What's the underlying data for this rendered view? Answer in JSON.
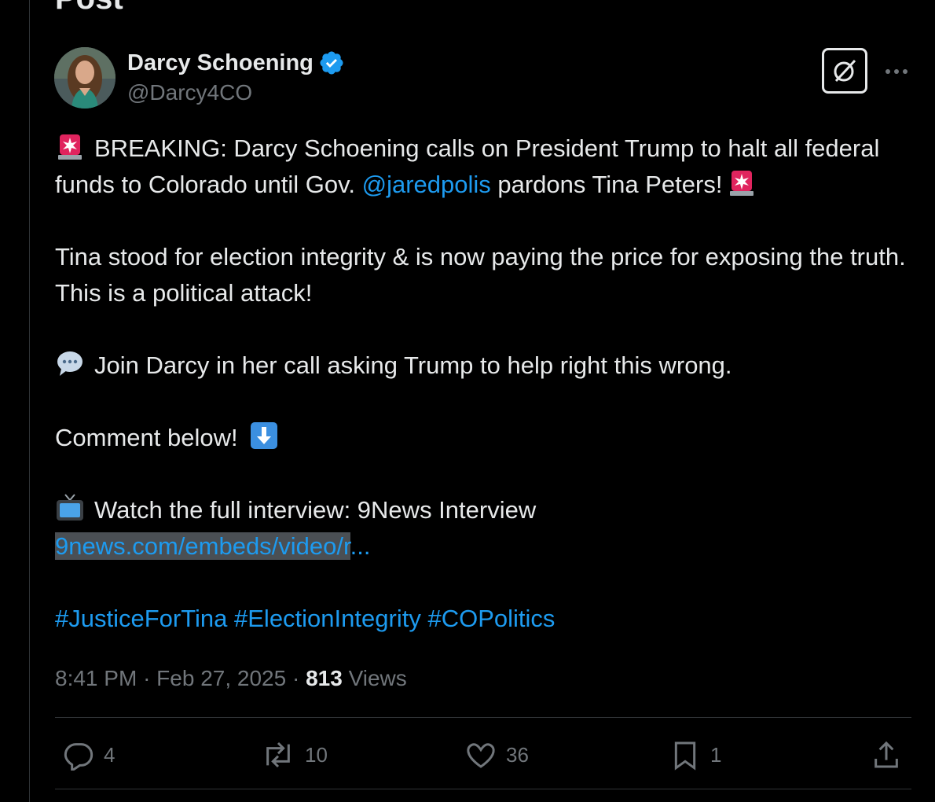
{
  "header": {
    "title": "Post"
  },
  "author": {
    "name": "Darcy Schoening",
    "handle": "@Darcy4CO",
    "avatar_icon": "profile-photo"
  },
  "tweet": {
    "line1_prefix": "BREAKING: Darcy Schoening calls on President Trump to halt all federal funds to Colorado until Gov. ",
    "mention": "@jaredpolis",
    "line1_suffix": " pardons Tina Peters!",
    "para2": "Tina stood for election integrity & is now paying the price for exposing the truth. This is a political attack!",
    "para3": "Join Darcy in her call asking Trump to help right this wrong.",
    "para4": "Comment below!",
    "para5_text": "Watch the full interview: 9News Interview",
    "para5_link": "9news.com/embeds/video/r",
    "para5_link_ellipsis": "...",
    "hashtags": [
      "#JusticeForTina",
      "#ElectionIntegrity",
      "#COPolitics"
    ]
  },
  "meta": {
    "time": "8:41 PM",
    "date": "Feb 27, 2025",
    "separator": "·",
    "views_count": "813",
    "views_label": "Views"
  },
  "actions": {
    "replies": "4",
    "reposts": "10",
    "likes": "36",
    "bookmarks": "1"
  },
  "colors": {
    "background": "#000000",
    "text": "#e7e9ea",
    "muted": "#71767b",
    "link": "#1d9bf0",
    "verified": "#1d9bf0",
    "border": "#2f3336"
  }
}
